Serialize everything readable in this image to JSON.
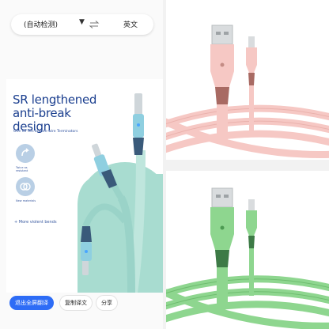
{
  "translate_bar": {
    "source_language": "(自动检测)",
    "target_language": "英文",
    "caret_icon": "triangle-down-icon",
    "swap_icon": "swap-arrows-icon"
  },
  "product": {
    "headline_line1": "SR lengthened",
    "headline_line2": "anti-break",
    "headline_line3": "design",
    "subline": "One for ten broken-wire Terminators",
    "feature1_label_line1": "Twice as",
    "feature1_label_line2": "resistant",
    "feature2_label": "New materials",
    "more_bends": "+ More violent bends"
  },
  "actions": {
    "exit_full": "退出全屏翻译",
    "copy_translation": "复制译文",
    "share": "分享"
  },
  "colors": {
    "accent": "#2d6cf6",
    "cable_pink": "#f6c8c4",
    "cable_green": "#8ed68f",
    "cable_blue": "#9ad3c8"
  }
}
